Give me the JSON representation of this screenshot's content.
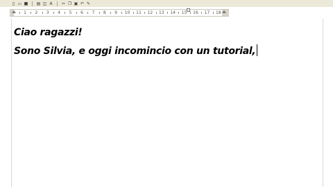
{
  "toolbar": {
    "buttons": [
      "new-document",
      "open",
      "save",
      "print",
      "print-preview",
      "spell-check",
      "cut",
      "copy",
      "paste",
      "undo",
      "format-painter"
    ]
  },
  "ruler": {
    "numbers": [
      "1",
      "2",
      "3",
      "4",
      "5",
      "6",
      "7",
      "8",
      "9",
      "10",
      "11",
      "12",
      "13",
      "14",
      "15",
      "16",
      "17",
      "18"
    ]
  },
  "document": {
    "lines": [
      "Ciao ragazzi!",
      "Sono Silvia, e oggi incomincio con un tutorial,"
    ]
  }
}
